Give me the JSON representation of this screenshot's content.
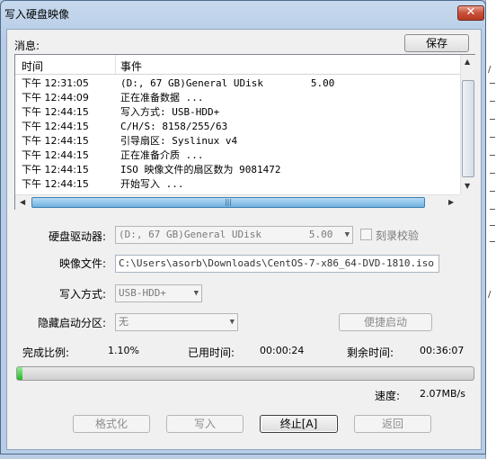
{
  "window": {
    "title": "写入硬盘映像",
    "close_glyph": "✕"
  },
  "messages": {
    "label": "消息:",
    "save_label": "保存",
    "columns": {
      "time": "时间",
      "event": "事件"
    },
    "rows": [
      {
        "time": "下午 12:31:05",
        "event": "(D:, 67 GB)General UDisk        5.00"
      },
      {
        "time": "下午 12:44:09",
        "event": "正在准备数据 ..."
      },
      {
        "time": "下午 12:44:15",
        "event": "写入方式: USB-HDD+"
      },
      {
        "time": "下午 12:44:15",
        "event": "C/H/S: 8158/255/63"
      },
      {
        "time": "下午 12:44:15",
        "event": "引导扇区: Syslinux v4"
      },
      {
        "time": "下午 12:44:15",
        "event": "正在准备介质 ..."
      },
      {
        "time": "下午 12:44:15",
        "event": "ISO 映像文件的扇区数为 9081472"
      },
      {
        "time": "下午 12:44:15",
        "event": "开始写入 ..."
      }
    ],
    "hscroll_grip": "|||"
  },
  "form": {
    "drive_label": "硬盘驱动器:",
    "drive_value": "(D:, 67 GB)General UDisk        5.00",
    "verify_label": "刻录校验",
    "image_label": "映像文件:",
    "image_value": "C:\\Users\\asorb\\Downloads\\CentOS-7-x86_64-DVD-1810.iso",
    "write_mode_label": "写入方式:",
    "write_mode_value": "USB-HDD+",
    "hidden_partition_label": "隐藏启动分区:",
    "hidden_partition_value": "无",
    "quick_boot_label": "便捷启动"
  },
  "progress": {
    "ratio_label": "完成比例:",
    "ratio_value": "1.10%",
    "percent": 1.1,
    "elapsed_label": "已用时间:",
    "elapsed_value": "00:00:24",
    "remaining_label": "剩余时间:",
    "remaining_value": "00:36:07",
    "speed_label": "速度:",
    "speed_value": "2.07MB/s"
  },
  "buttons": {
    "format": "格式化",
    "write": "写入",
    "abort": "终止[A]",
    "back": "返回"
  }
}
